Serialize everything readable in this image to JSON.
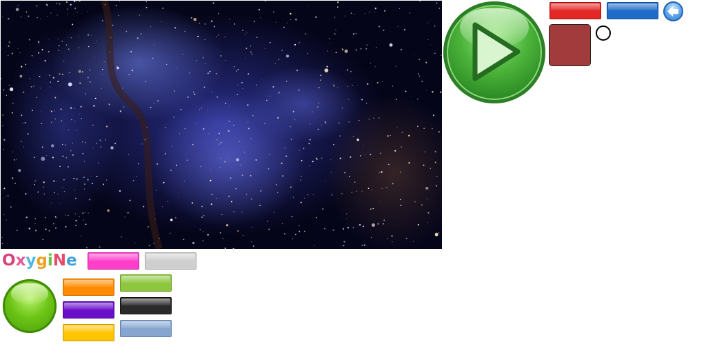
{
  "logo": {
    "letters": [
      "O",
      "x",
      "y",
      "g",
      "i",
      "N",
      "e"
    ],
    "colors": [
      "#d9417a",
      "#e25a9a",
      "#4fb8e8",
      "#f0a020",
      "#6cc04a",
      "#e64a6a",
      "#3ea2d8"
    ]
  },
  "buttons": {
    "play": {
      "icon": "play-icon"
    },
    "back": {
      "icon": "arrow-left-icon"
    }
  },
  "bar_colors": {
    "red": "#e32626",
    "blue": "#1f6cc8",
    "pink": "#ff3fcc",
    "gray": "#cfcfcf",
    "orange": "#ff8c00",
    "lime": "#8ec63f",
    "purple": "#6a0fc8",
    "black": "#2a2a2a",
    "yellow": "#ffc500",
    "steel": "#86a6d0"
  },
  "accents": {
    "play_green": "#3ea232",
    "tile_brown": "#a23b3b",
    "green_circle": "#6cc515"
  }
}
